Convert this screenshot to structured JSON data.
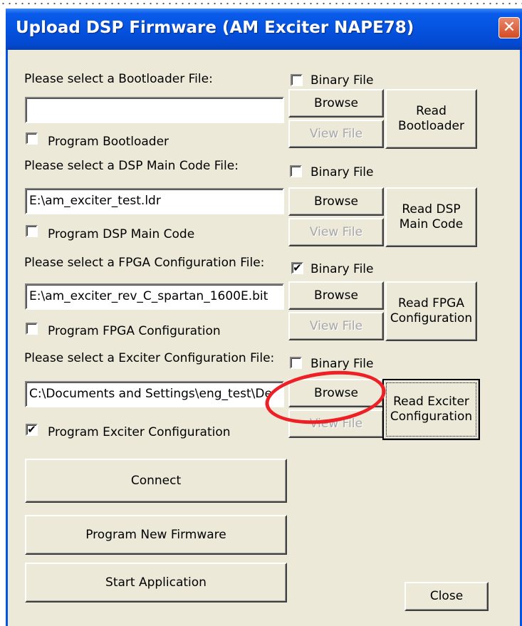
{
  "window": {
    "title": "Upload DSP Firmware (AM Exciter NAPE78)",
    "close_glyph": "✕"
  },
  "sections": [
    {
      "prompt": "Please select a Bootloader File:",
      "binary_label": "Binary File",
      "binary_checked": false,
      "file_value": "",
      "browse": "Browse",
      "view": "View File",
      "read_label": "Read Bootloader",
      "program_label": "Program Bootloader",
      "program_checked": false
    },
    {
      "prompt": "Please select a DSP Main Code File:",
      "binary_label": "Binary File",
      "binary_checked": false,
      "file_value": "E:\\am_exciter_test.ldr",
      "browse": "Browse",
      "view": "View File",
      "read_label": "Read DSP Main Code",
      "program_label": "Program DSP Main Code",
      "program_checked": false
    },
    {
      "prompt": "Please select a FPGA Configuration File:",
      "binary_label": "Binary File",
      "binary_checked": true,
      "file_value": "E:\\am_exciter_rev_C_spartan_1600E.bit",
      "browse": "Browse",
      "view": "View File",
      "read_label": "Read FPGA Configuration",
      "program_label": "Program FPGA Configuration",
      "program_checked": false
    },
    {
      "prompt": "Please select a Exciter Configuration File:",
      "binary_label": "Binary File",
      "binary_checked": false,
      "file_value": "C:\\Documents and Settings\\eng_test\\De",
      "browse": "Browse",
      "view": "View File",
      "read_label": "Read Exciter Configuration",
      "program_label": "Program Exciter Configuration",
      "program_checked": true
    }
  ],
  "actions": {
    "connect": "Connect",
    "program_new_firmware": "Program New Firmware",
    "start_application": "Start Application",
    "close": "Close"
  },
  "check_glyph": "✔",
  "colors": {
    "titlebar": "#0553e0",
    "dialog_bg": "#ece9d8",
    "annotation_circle": "#ee1f25",
    "close_button": "#d44a23"
  }
}
